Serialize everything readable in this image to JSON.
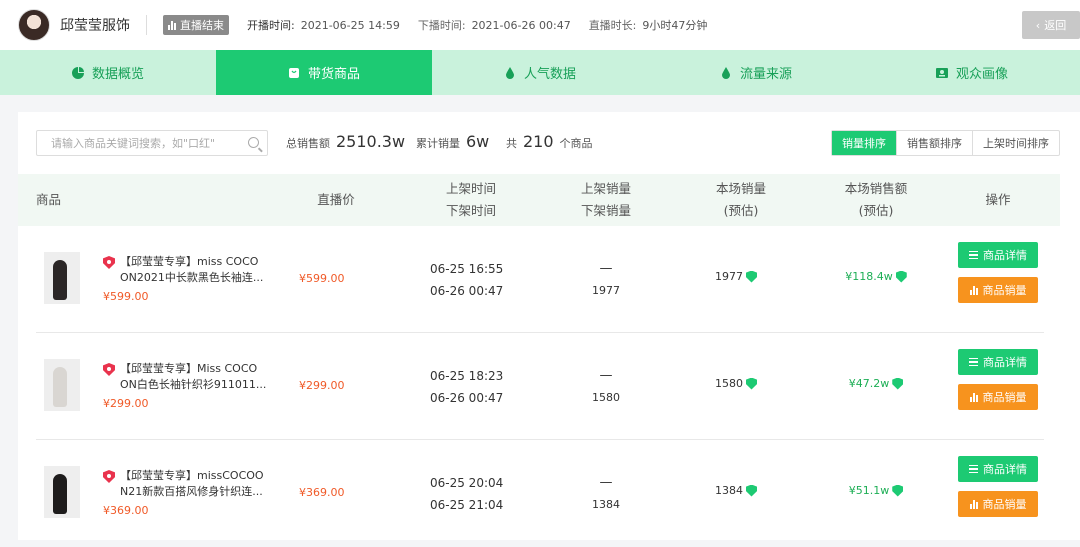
{
  "header": {
    "shop_name": "邱莹莹服饰",
    "live_status": "直播结束",
    "start_label": "开播时间:",
    "start_value": "2021-06-25 14:59",
    "end_label": "下播时间:",
    "end_value": "2021-06-26 00:47",
    "duration_label": "直播时长:",
    "duration_value": "9小时47分钟",
    "back_label": "返回"
  },
  "tabs": [
    {
      "label": "数据概览",
      "icon": "pie-icon",
      "active": false
    },
    {
      "label": "带货商品",
      "icon": "bag-icon",
      "active": true
    },
    {
      "label": "人气数据",
      "icon": "drop-icon",
      "active": false
    },
    {
      "label": "流量来源",
      "icon": "drop-icon",
      "active": false
    },
    {
      "label": "观众画像",
      "icon": "profile-icon",
      "active": false
    }
  ],
  "toolbar": {
    "search_placeholder": "请输入商品关键词搜索，如\"口红\"",
    "total_sales_label": "总销售额",
    "total_sales_value": "2510.3w",
    "total_volume_label": "累计销量",
    "total_volume_value": "6w",
    "count_prefix": "共",
    "count_value": "210",
    "count_suffix": "个商品",
    "sort_options": [
      "销量排序",
      "销售额排序",
      "上架时间排序"
    ],
    "sort_active": "销量排序"
  },
  "table": {
    "headers": {
      "product": "商品",
      "live_price": "直播价",
      "listed_time": "上架时间",
      "delisted_time": "下架时间",
      "listed_sales": "上架销量",
      "delisted_sales": "下架销量",
      "session_sales": "本场销量",
      "session_sales_sub": "(预估)",
      "session_amount": "本场销售额",
      "session_amount_sub": "(预估)",
      "actions": "操作"
    },
    "rows": [
      {
        "name_line1": "【邱莹莹专享】miss COCO",
        "name_line2": "ON2021中长款黑色长袖连...",
        "price": "¥599.00",
        "live_price": "¥599.00",
        "listed_time": "06-25 16:55",
        "delisted_time": "06-26 00:47",
        "listed_sales": "—",
        "delisted_sales": "1977",
        "session_sales": "1977",
        "session_amount": "¥118.4w",
        "thumb_color": "#2b2626"
      },
      {
        "name_line1": "【邱莹莹专享】Miss COCO",
        "name_line2": "ON白色长袖针织衫911011...",
        "price": "¥299.00",
        "live_price": "¥299.00",
        "listed_time": "06-25 18:23",
        "delisted_time": "06-26 00:47",
        "listed_sales": "—",
        "delisted_sales": "1580",
        "session_sales": "1580",
        "session_amount": "¥47.2w",
        "thumb_color": "#d9d6d2"
      },
      {
        "name_line1": "【邱莹莹专享】missCOCOO",
        "name_line2": "N21新款百搭风修身针织连...",
        "price": "¥369.00",
        "live_price": "¥369.00",
        "listed_time": "06-25 20:04",
        "delisted_time": "06-25 21:04",
        "listed_sales": "—",
        "delisted_sales": "1384",
        "session_sales": "1384",
        "session_amount": "¥51.1w",
        "thumb_color": "#1e1c1c"
      }
    ],
    "detail_button": "商品详情",
    "sales_button": "商品销量"
  },
  "colors": {
    "accent": "#1dca73",
    "tab_bg": "#c9f2dc",
    "price": "#f05a28",
    "amount": "#1dae55",
    "sales_button": "#f7931e"
  }
}
